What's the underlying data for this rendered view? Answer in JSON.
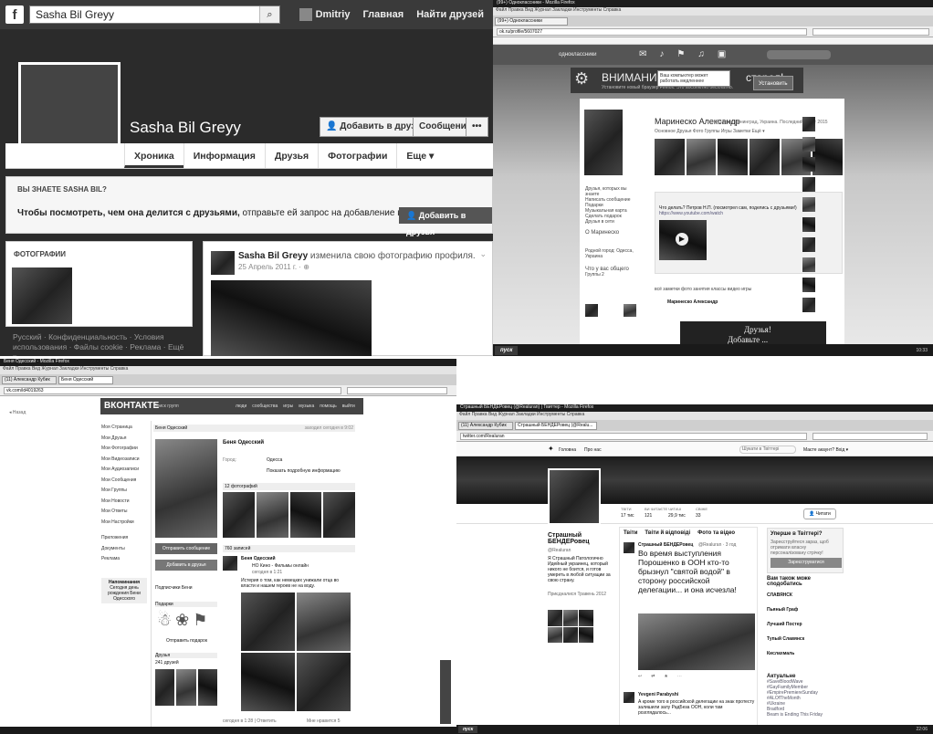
{
  "fb": {
    "search": "Sasha Bil Greyy",
    "search_icon": "search-icon",
    "nav_user": "Dmitriy",
    "nav_home": "Главная",
    "nav_find": "Найти друзей",
    "name": "Sasha Bil Greyy",
    "add_friend": "Добавить в друзья",
    "message": "Сообщение",
    "more": "•••",
    "tabs": [
      "Хроника",
      "Информация",
      "Друзья",
      "Фотографии",
      "Еще ▾"
    ],
    "know_title": "ВЫ ЗНАЕТЕ SASHA BIL?",
    "know_text_a": "Чтобы посмотреть, чем она делится с друзьями,",
    "know_text_b": " отправьте ей запрос на добавление в друзья.",
    "know_btn": "Добавить в друзья",
    "photos_title": "ФОТОГРАФИИ",
    "footer": "Русский · Конфиденциальность · Условия использования · Файлы cookie · Реклама · Ещё ▾",
    "post_author": "Sasha Bil Greyy",
    "post_action": " изменила свою фотографию профиля.",
    "post_date": "25 Апрель 2011 г. · "
  },
  "ok": {
    "window_title": "(99+) Одноклассники - Mozilla Firefox",
    "menu": "Файл  Правка  Вид  Журнал  Закладки  Инструменты  Справка",
    "tab1": "(99+) Одноклассники",
    "url": "ok.ru/profile/5607027",
    "site": "одноклассники",
    "warn_title": "ВНИМАНИЕ!",
    "warn_tail": "старел!",
    "warn_text": "Установите новый браузер Firefox. Это абсолютно бесплатно.",
    "install": "Установить",
    "popup": "Ваш компьютер может работать медленнее",
    "name": "Маринеско Александр",
    "meta": "43 года, Ленинград, Украина. Последний визит 2015",
    "tabs": "Основное  Друзья  Фото  Группы  Игры  Заметки  Ещё ▾",
    "left_links": [
      "Друзья, которых вы знаете",
      "Написать сообщение",
      "Подарки",
      "Музыкальная карта",
      "Сделать подарок",
      "Друзья в сети"
    ],
    "about": "О Маринеско",
    "born": "Родной город: Одесса, Украина",
    "common": "Что у вас общего",
    "groups": "Группы 2",
    "post_text": "Что делать? Петров Н.П. (посмотрел сам, поделись с друзьями!)",
    "post_link": "https://www.youtube.com/watch",
    "feed_tabs": "всё  заметки  фото  занятия  классы  видео  игры",
    "feed_author": "Маринеско Александр",
    "card_text": "Друзья!",
    "card_text2": "Добавьте ...",
    "taskbar_start": "пуск",
    "taskbar_clock": "10:33"
  },
  "vk": {
    "window_title": "Беня Одесский - Mozilla Firefox",
    "menu": "Файл  Правка  Вид  Журнал  Закладки  Инструменты  Справка",
    "tab1": "(11) Александр Кубик",
    "tab2": "Беня Одесский",
    "url": "vk.com/id4019263",
    "back": "Назад",
    "logo": "ВКОНТАКТЕ",
    "top_search": "Поиск групп",
    "top_links": [
      "люди",
      "сообщества",
      "игры",
      "музыка",
      "помощь",
      "выйти"
    ],
    "menu_items": [
      "Моя Страница",
      "Мои Друзья",
      "Мои Фотографии",
      "Мои Видеозаписи",
      "Мои Аудиозаписи",
      "Мои Сообщения",
      "Мои Группы",
      "Мои Новости",
      "Мои Ответы",
      "Мои Настройки"
    ],
    "side_more": [
      "Приложения",
      "Документы",
      "Реклама"
    ],
    "reminder_title": "Напоминания",
    "reminder": "Сегодня день рождения Бени Одесского",
    "name": "Беня Одесский",
    "online": "заходил сегодня в 9:02",
    "city_label": "Город:",
    "city": "Одесса",
    "more_info": "Показать подробную информацию",
    "photos": "12 фотографий",
    "send": "Отправить сообщение",
    "add": "Добавить в друзья",
    "subs": "Подписчики Бени",
    "gifts": "Подарки",
    "send_gift": "Отправить подарок",
    "friends": "Друзья",
    "friends_count": "241 друзей",
    "wall": "760 записей",
    "wall_author": "Беня Одесский",
    "wall_repost": "НО Кино - Фильмы онлайн",
    "wall_date": "сегодня в 1:21",
    "wall_text": "Истерия о том, как немецких унижали отца во власти и нашем героев не на воду.",
    "wall_footer": "сегодня в 1:28 | Ответить",
    "like": "Мне нравится 5"
  },
  "tw": {
    "window_title": "Страшный БЕНДЕРовец (@Realuran) | Твиттер - Mozilla Firefox",
    "menu": "Файл  Правка  Вид  Журнал  Закладки  Инструменты  Справка",
    "tab1": "(11) Александр Кубик",
    "tab2": "Страшный БЕНДЕРовец (@Realu...",
    "url": "twitter.com/Realuran",
    "nav": [
      "Головна",
      "Про нас"
    ],
    "search": "Шукати в Твіттері",
    "login": "Маєте акаунт? Вхід ▾",
    "stats_labels": [
      "ТВІТИ",
      "ВИ ЧИТАЄТЕ",
      "ЧИТАЧІ",
      "СВІЖЕ"
    ],
    "stats": [
      "17 тис",
      "121",
      "29,9 тис",
      "33"
    ],
    "follow": "Читати",
    "name": "Страшный БЕНДЕРовец",
    "handle": "@Realuran",
    "bio": "Я Страшный Патологично Идейный украинец, который никого не боится, и готов умереть в любой ситуации за свою страну.",
    "joined": "Приєдналися Травень 2012",
    "feed_tabs": [
      "Твіти",
      "Твіти й відповіді",
      "Фото та відео"
    ],
    "tweet_author": "Страшный БЕНДЕРовец",
    "tweet_meta": "@Realuran · 3 год",
    "tweet": "Во время выступления Порошенко в ООН кто-то брызнул \"святой водой\" в сторону российской делегации... и она исчезла!",
    "tweet2_author": "Yevgeni Parabyshi",
    "tweet2": "А кроме того в российской делегации на знак протесту залишили залу РадБеза ООН, коли там розглядалось...",
    "join_title": "Уперше в Твіттері?",
    "join_text": "Зареєструйтеся зараз, щоб отримати власну персоналізовану стрічку!",
    "join_btn": "Зареєструватися",
    "wtf_title": "Вам також може сподобатись",
    "wtf": [
      "СЛАВЯНСК",
      "Пьяный Граф",
      "Лучший Постер",
      "Тупый Славянск",
      "Кислахмаль"
    ],
    "trends_title": "Актуальне",
    "trends": [
      "#SaveBloodWave",
      "#GayFamilyMember",
      "#EmpirePremiereSunday",
      "#ALOfTheMonth",
      "#Ukraine",
      "Bradford",
      "Beam is Ending This Friday"
    ],
    "taskbar_start": "пуск",
    "clock": "22:06"
  }
}
